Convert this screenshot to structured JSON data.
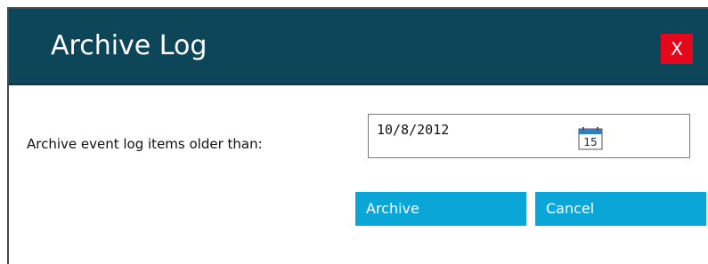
{
  "dialog": {
    "title": "Archive Log",
    "close_label": "X",
    "field_label": "Archive event log items older than:",
    "date_value": "10/8/2012",
    "calendar_day": "15",
    "archive_label": "Archive",
    "cancel_label": "Cancel"
  },
  "icons": {
    "calendar": "calendar-icon"
  },
  "colors": {
    "titlebar": "#0d4559",
    "close_button": "#e3081b",
    "action_button": "#0aa6d8"
  }
}
